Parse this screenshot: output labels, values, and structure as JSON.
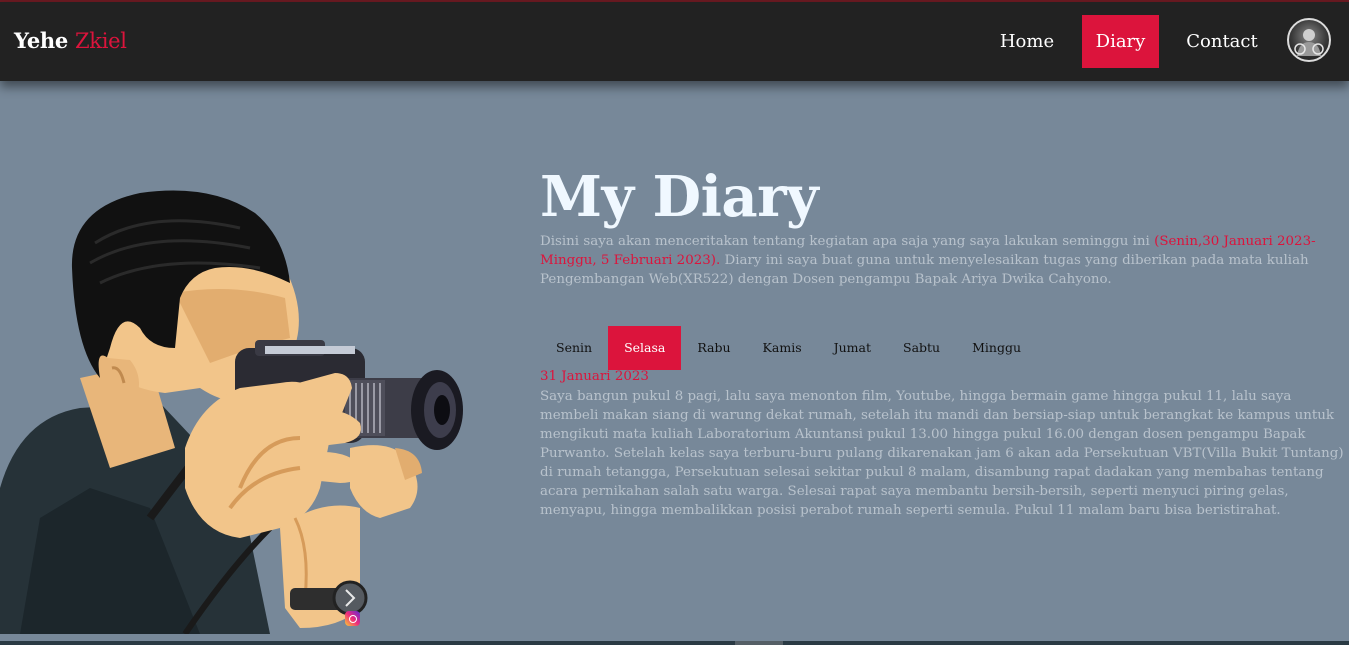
{
  "brand": {
    "first": "Yehe",
    "second": "Zkiel"
  },
  "nav": {
    "home": "Home",
    "diary": "Diary",
    "contact": "Contact"
  },
  "hero": {
    "title": "My Diary",
    "intro_before": "Disini saya akan menceritakan tentang kegiatan apa saja yang saya lakukan seminggu ini ",
    "intro_highlight": "(Senin,30 Januari 2023- Minggu, 5 Februari 2023).",
    "intro_after": " Diary ini saya buat guna untuk menyelesaikan tugas yang diberikan pada mata kuliah Pengembangan Web(XR522) dengan Dosen pengampu Bapak Ariya Dwika Cahyono."
  },
  "tabs": [
    {
      "label": "Senin",
      "active": false
    },
    {
      "label": "Selasa",
      "active": true
    },
    {
      "label": "Rabu",
      "active": false
    },
    {
      "label": "Kamis",
      "active": false
    },
    {
      "label": "Jumat",
      "active": false
    },
    {
      "label": "Sabtu",
      "active": false
    },
    {
      "label": "Minggu",
      "active": false
    }
  ],
  "entry": {
    "date": "31 Januari 2023",
    "text": "Saya bangun pukul 8 pagi, lalu saya menonton film, Youtube, hingga bermain game hingga pukul 11, lalu saya membeli makan siang di warung dekat rumah, setelah itu mandi dan bersiap-siap untuk berangkat ke kampus untuk mengikuti mata kuliah Laboratorium Akuntansi pukul 13.00 hingga pukul 16.00 dengan dosen pengampu Bapak Purwanto. Setelah kelas saya terburu-buru pulang dikarenakan jam 6 akan ada Persekutuan VBT(Villa Bukit Tuntang) di rumah tetangga, Persekutuan selesai sekitar pukul 8 malam, disambung rapat dadakan yang membahas tentang acara pernikahan salah satu warga. Selesai rapat saya membantu bersih-bersih, seperti menyuci piring gelas, menyapu, hingga membalikkan posisi perabot rumah seperti semula. Pukul 11 malam baru bisa beristirahat."
  },
  "colors": {
    "accent": "#dc143c",
    "navbar": "#222222",
    "page_bg": "#778899",
    "title": "#f0f8ff",
    "body_text": "#b8c2cc"
  },
  "icons": {
    "avatar": "profile-avatar",
    "illustration": "photographer-illustration",
    "instagram": "instagram-icon"
  }
}
